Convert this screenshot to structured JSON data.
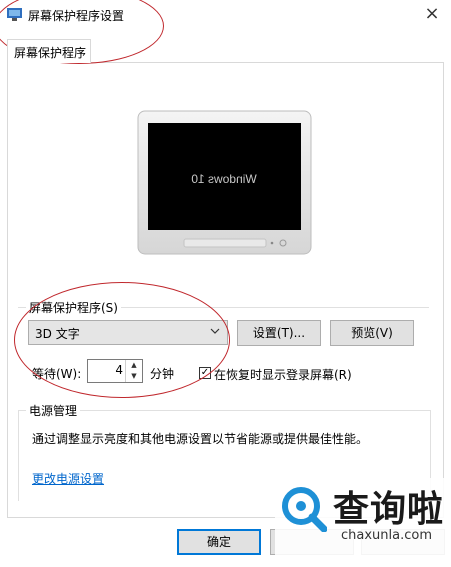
{
  "window": {
    "title": "屏幕保护程序设置",
    "close_glyph": "×"
  },
  "tabs": [
    {
      "label": "屏幕保护程序",
      "active": true
    }
  ],
  "preview": {
    "screen_text": "Windows 10",
    "mirrored": true
  },
  "screensaver": {
    "group_label": "屏幕保护程序(S)",
    "selected": "3D 文字",
    "settings_label": "设置(T)...",
    "preview_label": "预览(V)",
    "wait_label": "等待(W):",
    "wait_value": "4",
    "minutes_label": "分钟",
    "resume_checked": true,
    "resume_label": "在恢复时显示登录屏幕(R)"
  },
  "power": {
    "group_label": "电源管理",
    "description": "通过调整显示亮度和其他电源设置以节省能源或提供最佳性能。",
    "link": "更改电源设置"
  },
  "footer": {
    "ok_label": "确定"
  },
  "watermark": {
    "brand": "查询啦",
    "domain": "chaxunla.com"
  },
  "colors": {
    "annotation": "#c0282d",
    "accent": "#0078d7",
    "link": "#0066cc",
    "watermark_blue": "#1e90d6"
  }
}
